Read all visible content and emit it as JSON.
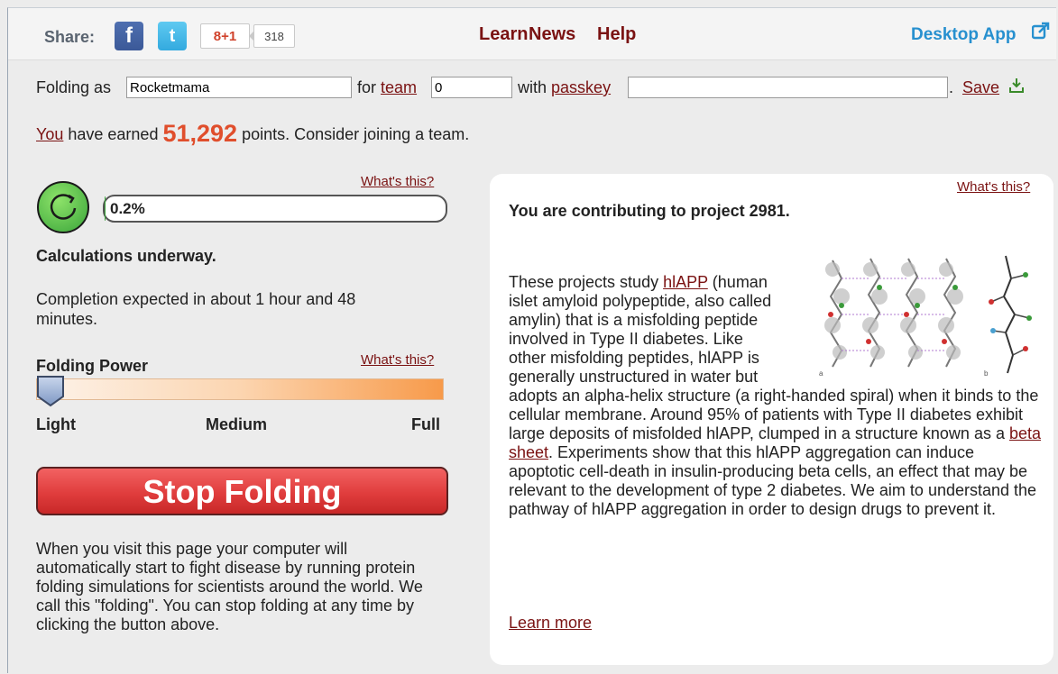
{
  "header": {
    "share_label": "Share:",
    "facebook_glyph": "f",
    "twitter_glyph": "t",
    "gplus_label": "8+1",
    "gplus_count": "318",
    "nav": {
      "learn": "Learn",
      "news": "News",
      "help": "Help"
    },
    "desktop_app": "Desktop App"
  },
  "identity": {
    "folding_as_label": "Folding as",
    "username_value": "Rocketmama",
    "for_label": "for",
    "team_link": "team",
    "team_value": "0",
    "with_label": "with",
    "passkey_link": "passkey",
    "passkey_value": "",
    "dot": ".",
    "save_link": "Save"
  },
  "points": {
    "you_link": "You",
    "earned_prefix": " have earned ",
    "value": "51,292",
    "earned_suffix": " points. Consider joining a team."
  },
  "progress": {
    "whats_this": "What's this?",
    "percent_text": "0.2%",
    "fraction": 0.002,
    "status": "Calculations underway.",
    "completion": "Completion expected in about 1 hour and 48 minutes."
  },
  "folding_power": {
    "label": "Folding Power",
    "whats_this": "What's this?",
    "level": "Light",
    "ticks": {
      "light": "Light",
      "medium": "Medium",
      "full": "Full"
    }
  },
  "stop_button": "Stop Folding",
  "description": "When you visit this page your computer will automatically start to fight disease by running protein folding simulations for scientists around the world. We call this \"folding\". You can stop folding at any time by clicking the button above.",
  "project": {
    "whats_this": "What's this?",
    "title": "You are contributing to project 2981.",
    "p1": "These projects study ",
    "hlapp_link": "hlAPP",
    "p2": " (human islet amyloid polypeptide, also called amylin) that is a misfolding peptide involved in Type II diabetes. Like other misfolding peptides, hlAPP is generally unstructured in water but adopts an alpha-helix structure (a right-handed spiral) when it binds to the cellular membrane. Around 95% of patients with Type II diabetes exhibit large deposits of misfolded hlAPP, clumped in a structure known as a ",
    "beta_link": "beta sheet",
    "p3": ". Experiments show that this hlAPP aggregation can induce apoptotic cell-death in insulin-producing beta cells, an effect that may be relevant to the development of type 2 diabetes. We aim to understand the pathway of hlAPP aggregation in order to design drugs to prevent it.",
    "figure_label_a": "a",
    "figure_label_b": "b",
    "learn_more": "Learn more"
  },
  "colors": {
    "link": "#7a1212",
    "points": "#e04e2c",
    "desktop_app": "#2790cf",
    "stop_button": "#e03d3d",
    "progress": "#3aa53a"
  },
  "icons": [
    "facebook-icon",
    "twitter-icon",
    "external-link-icon",
    "save-icon",
    "refresh-icon",
    "slider-handle-icon"
  ]
}
